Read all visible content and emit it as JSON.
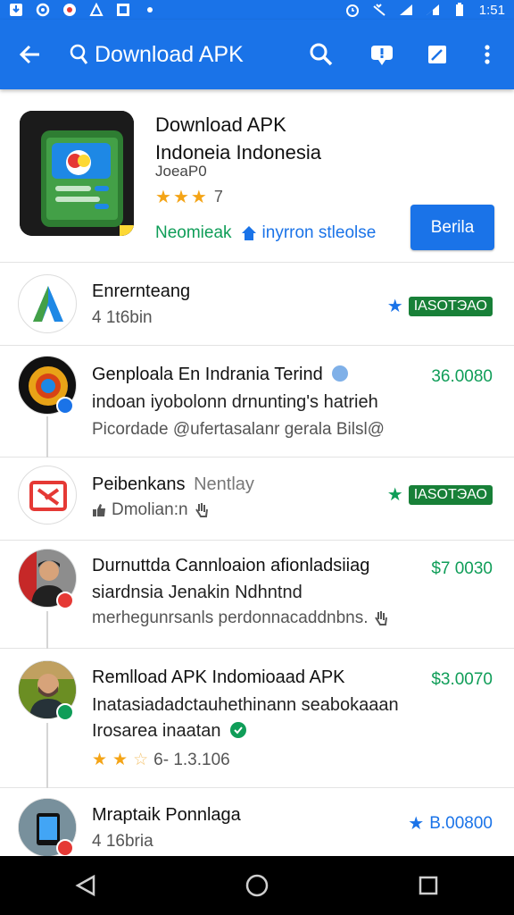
{
  "status_bar": {
    "time": "1:51"
  },
  "app_bar": {
    "title": "Download APK"
  },
  "hero": {
    "title_line1": "Download APK",
    "title_line2": "Indoneia Indonesia",
    "subtitle": "JoeaP0",
    "rating_count": "7",
    "tag_green": "Neomieak",
    "tag_blue": "inyrron stleolse",
    "button_label": "Berila"
  },
  "rows": [
    {
      "title": "Enrernteang",
      "meta": "4  1t6bin",
      "price": "ІАЅΟΤЭΑΟ",
      "price_style": "pill-blue"
    },
    {
      "title": "Genploala En Indrania Terind",
      "line2": "indoan iyobolonn drnunting's hatrieh",
      "line3": "Picordade @ufertasalanr gerala  Bilsl@",
      "price": "36.0080"
    },
    {
      "title": "Peibenkans",
      "title_suffix": "Nentlay",
      "meta": "Dmolian:n",
      "price": "ІАЅОΤЭΑΟ",
      "price_style": "pill-green"
    },
    {
      "title": "Durnuttda Cannloaion afionladsiiag",
      "line2": "siardnsia Jenakin Ndhntnd",
      "line3": "merhegunrsanls perdonnacaddnbns.",
      "price": "$7 0030"
    },
    {
      "title": "Remlload APK Indomioaad APK",
      "line2": "Inatasiadadctauhethinann seabokaaan",
      "line3": "Irosarea inaatan",
      "meta": "6- 1.3.106",
      "price": "$3.0070"
    },
    {
      "title": "Mraptaik Ponnlaga",
      "meta": "4  16bria",
      "price": "B.00800",
      "price_style": "blue"
    }
  ],
  "colors": {
    "primary": "#1a73e8",
    "green": "#0f9d58",
    "star": "#f4a416"
  }
}
